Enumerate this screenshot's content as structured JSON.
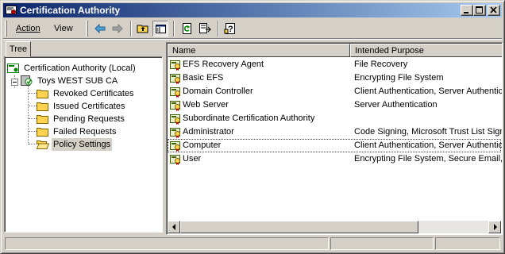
{
  "window": {
    "title": "Certification Authority"
  },
  "menu": {
    "action": "Action",
    "view": "View"
  },
  "icons": [
    "back-arrow-icon",
    "forward-arrow-icon",
    "up-folder-icon",
    "show-hide-tree-icon",
    "refresh-icon",
    "export-list-icon",
    "help-icon"
  ],
  "tree": {
    "tab": "Tree",
    "root": "Certification Authority (Local)",
    "ca": "Toys WEST SUB CA",
    "children": [
      "Revoked Certificates",
      "Issued Certificates",
      "Pending Requests",
      "Failed Requests",
      "Policy Settings"
    ],
    "selected": "Policy Settings"
  },
  "list": {
    "columns": [
      "Name",
      "Intended Purpose"
    ],
    "rows": [
      {
        "name": "EFS Recovery Agent",
        "purpose": "File Recovery"
      },
      {
        "name": "Basic EFS",
        "purpose": "Encrypting File System"
      },
      {
        "name": "Domain Controller",
        "purpose": "Client Authentication, Server Authentic"
      },
      {
        "name": "Web Server",
        "purpose": "Server Authentication"
      },
      {
        "name": "Subordinate Certification Authority",
        "purpose": ""
      },
      {
        "name": "Administrator",
        "purpose": "Code Signing, Microsoft Trust List Signi"
      },
      {
        "name": "Computer",
        "purpose": "Client Authentication, Server Authentic"
      },
      {
        "name": "User",
        "purpose": "Encrypting File System, Secure Email, C"
      }
    ],
    "focused_row": "Computer"
  },
  "colors": {
    "title_start": "#0a246a",
    "title_end": "#a6caf0",
    "face": "#d4d0c8",
    "folder": "#ffd34d"
  }
}
